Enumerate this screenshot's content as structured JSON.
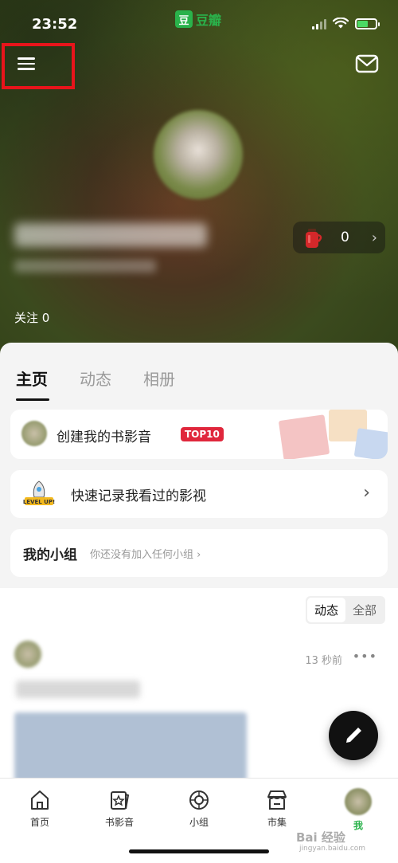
{
  "status_bar": {
    "time": "23:52",
    "app_label": "豆瓣",
    "app_icon_char": "豆"
  },
  "header": {
    "drink_count": "0",
    "follow_label": "关注 0",
    "icons": {
      "menu": "menu-icon",
      "mail": "mail-icon",
      "drink": "thermos-icon"
    }
  },
  "profile_tabs": [
    "主页",
    "动态",
    "相册"
  ],
  "cards": {
    "create_list": {
      "label": "创建我的书影音",
      "badge": "TOP10"
    },
    "quick_record": {
      "label": "快速记录我看过的影视",
      "rocket_text": "LEVEL UP!"
    },
    "groups": {
      "label": "我的小组",
      "hint": "你还没有加入任何小组",
      "chevron": "›"
    }
  },
  "feed": {
    "filter": [
      "动态",
      "全部"
    ],
    "post": {
      "time": "13 秒前",
      "more": "•••"
    }
  },
  "tabbar": [
    {
      "label": "首页",
      "icon": "home-icon"
    },
    {
      "label": "书影音",
      "icon": "star-book-icon"
    },
    {
      "label": "小组",
      "icon": "group-icon"
    },
    {
      "label": "市集",
      "icon": "store-icon"
    },
    {
      "label": "我",
      "icon": "avatar"
    }
  ],
  "watermark": {
    "text": "Bai 经验",
    "sub": "jingyan.baidu.com"
  },
  "colors": {
    "brand_green": "#2ab24b",
    "highlight_red": "#e8141b",
    "badge_red": "#e0273c"
  }
}
